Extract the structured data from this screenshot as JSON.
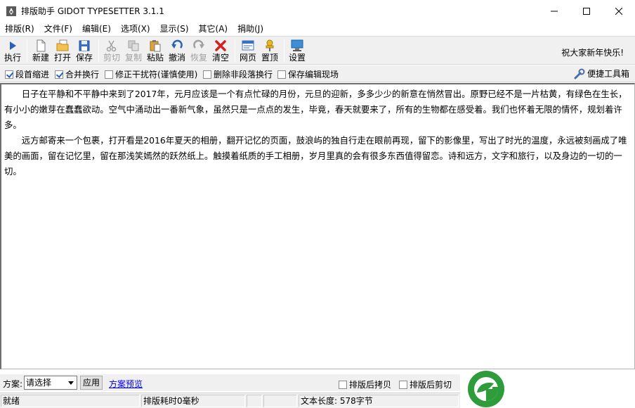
{
  "window": {
    "title": "排版助手 GIDOT TYPESETTER 3.1.1"
  },
  "menu": [
    {
      "label": "排版(R)"
    },
    {
      "label": "文件(F)"
    },
    {
      "label": "编辑(E)"
    },
    {
      "label": "选项(X)"
    },
    {
      "label": "显示(S)"
    },
    {
      "label": "其它(A)"
    },
    {
      "label": "捐助(J)"
    }
  ],
  "toolbar": {
    "execute": "执行",
    "new": "新建",
    "open": "打开",
    "save": "保存",
    "cut": "剪切",
    "copy": "复制",
    "paste": "粘贴",
    "undo": "撤消",
    "redo": "恢复",
    "clear": "清空",
    "webpage": "网页",
    "pin": "置顶",
    "settings": "设置",
    "greeting": "祝大家新年快乐!"
  },
  "options": {
    "indent": {
      "label": "段首缩进",
      "checked": true
    },
    "merge": {
      "label": "合并换行",
      "checked": true
    },
    "fix_chars": {
      "label": "修正干扰符(谨慎使用)",
      "checked": false
    },
    "remove_non_para": {
      "label": "删除非段落换行",
      "checked": false
    },
    "keep_scene": {
      "label": "保存编辑现场",
      "checked": false
    },
    "quick_tools": "便捷工具箱"
  },
  "editor": {
    "paragraphs": [
      "日子在平静和不平静中来到了2017年，元月应该是一个有点忙碌的月份，元旦的迎新，多多少少的新意在悄然冒出。原野已经不是一片枯黄，有绿色在生长，有小小的嫩芽在蠢蠢欲动。空气中涌动出一番新气象，虽然只是一点点的发生，毕竟，春天就要来了，所有的生物都在感受着。我们也怀着无限的情怀，规划着许多。",
      "远方邮寄来一个包裹，打开看是2016年夏天的相册，翻开记忆的页面，鼓浪屿的独自行走在眼前再现，留下的影像里，写出了时光的温度，永远被刻画成了唯美的画面，留在记忆里，留在那浅笑嫣然的跃然纸上。触摸着纸质的手工相册，岁月里真的会有很多东西值得留恋。诗和远方，文字和旅行，以及身边的一切的一切。"
    ]
  },
  "scheme": {
    "label": "方案:",
    "selected": "请选择",
    "apply": "应用",
    "preview": "方案预览",
    "copy_after": {
      "label": "排版后拷贝",
      "checked": false
    },
    "cut_after": {
      "label": "排版后剪切",
      "checked": false
    }
  },
  "status": {
    "state": "就绪",
    "time": "排版耗时0毫秒",
    "length": "文本长度: 578字节"
  },
  "colors": {
    "accent_blue": "#2a62b8",
    "logo_green": "#2e9c3a",
    "clear_red": "#d42020"
  }
}
